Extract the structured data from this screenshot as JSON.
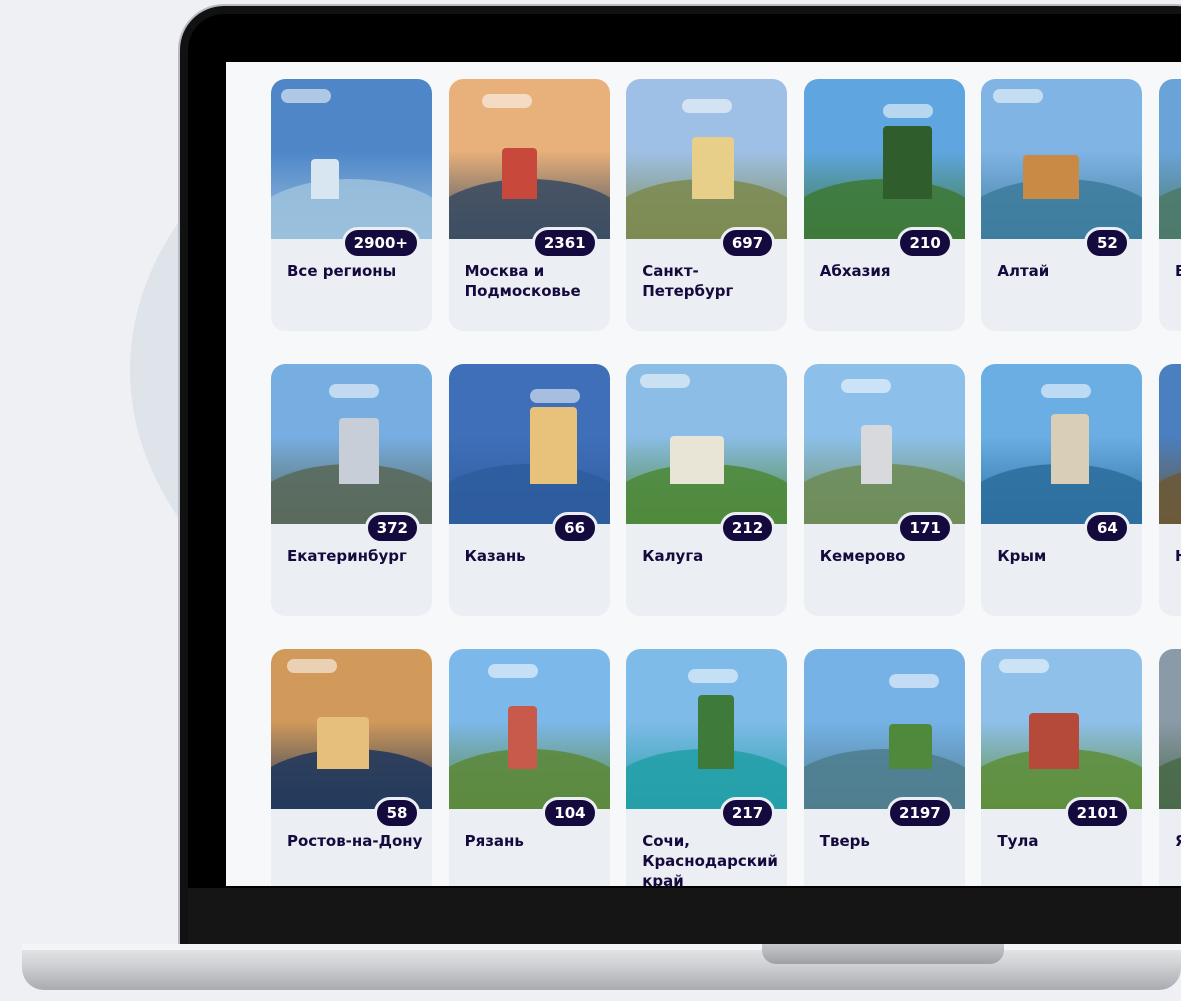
{
  "regions": [
    {
      "name": "Все регионы",
      "count": "2900+",
      "sky": "#4e86c8",
      "ground": "#9ac0dc",
      "accent": "#d8e6f2"
    },
    {
      "name": "Москва и Подмосковье",
      "count": "2361",
      "sky": "#e8b07a",
      "ground": "#3d4e63",
      "accent": "#c9483c"
    },
    {
      "name": "Санкт-Петербург",
      "count": "697",
      "sky": "#9ec0e6",
      "ground": "#7d8b52",
      "accent": "#e7cf8a"
    },
    {
      "name": "Абхазия",
      "count": "210",
      "sky": "#5fa6e0",
      "ground": "#3e7a3a",
      "accent": "#2f5d2b"
    },
    {
      "name": "Алтай",
      "count": "52",
      "sky": "#7fb4e4",
      "ground": "#3f7d9e",
      "accent": "#c98a45"
    },
    {
      "name": "В",
      "count": "",
      "sky": "#6aa3d8",
      "ground": "#4d7a6a",
      "accent": "#cfc8a0"
    },
    {
      "name": "Екатеринбург",
      "count": "372",
      "sky": "#77aee2",
      "ground": "#5a6a5c",
      "accent": "#c7ced8"
    },
    {
      "name": "Казань",
      "count": "66",
      "sky": "#3f6fb8",
      "ground": "#2e5c9e",
      "accent": "#e8c27a"
    },
    {
      "name": "Калуга",
      "count": "212",
      "sky": "#8bbde6",
      "ground": "#4f8a3c",
      "accent": "#e9e5d6"
    },
    {
      "name": "Кемерово",
      "count": "171",
      "sky": "#8cc0ea",
      "ground": "#6f8d5a",
      "accent": "#d7d9dc"
    },
    {
      "name": "Крым",
      "count": "64",
      "sky": "#6aaee4",
      "ground": "#2d6f9e",
      "accent": "#d9cfb8"
    },
    {
      "name": "Н",
      "count": "",
      "sky": "#4a7fc0",
      "ground": "#6b5a3a",
      "accent": "#c8a46a"
    },
    {
      "name": "Ростов-на-Дону",
      "count": "58",
      "sky": "#d19a5a",
      "ground": "#243a5c",
      "accent": "#e6c07a"
    },
    {
      "name": "Рязань",
      "count": "104",
      "sky": "#7db8ea",
      "ground": "#5c8a3e",
      "accent": "#c75a4a"
    },
    {
      "name": "Сочи, Краснодарский край",
      "count": "217",
      "sky": "#7fbbe8",
      "ground": "#25a0a8",
      "accent": "#3e7a3a"
    },
    {
      "name": "Тверь",
      "count": "2197",
      "sky": "#76b2e6",
      "ground": "#4f7e8f",
      "accent": "#4f8a3c"
    },
    {
      "name": "Тула",
      "count": "2101",
      "sky": "#8fc0ea",
      "ground": "#5f8f3e",
      "accent": "#b64a3a"
    },
    {
      "name": "Я",
      "count": "",
      "sky": "#8a9aa8",
      "ground": "#4a6a4a",
      "accent": "#c9c0a8"
    }
  ]
}
